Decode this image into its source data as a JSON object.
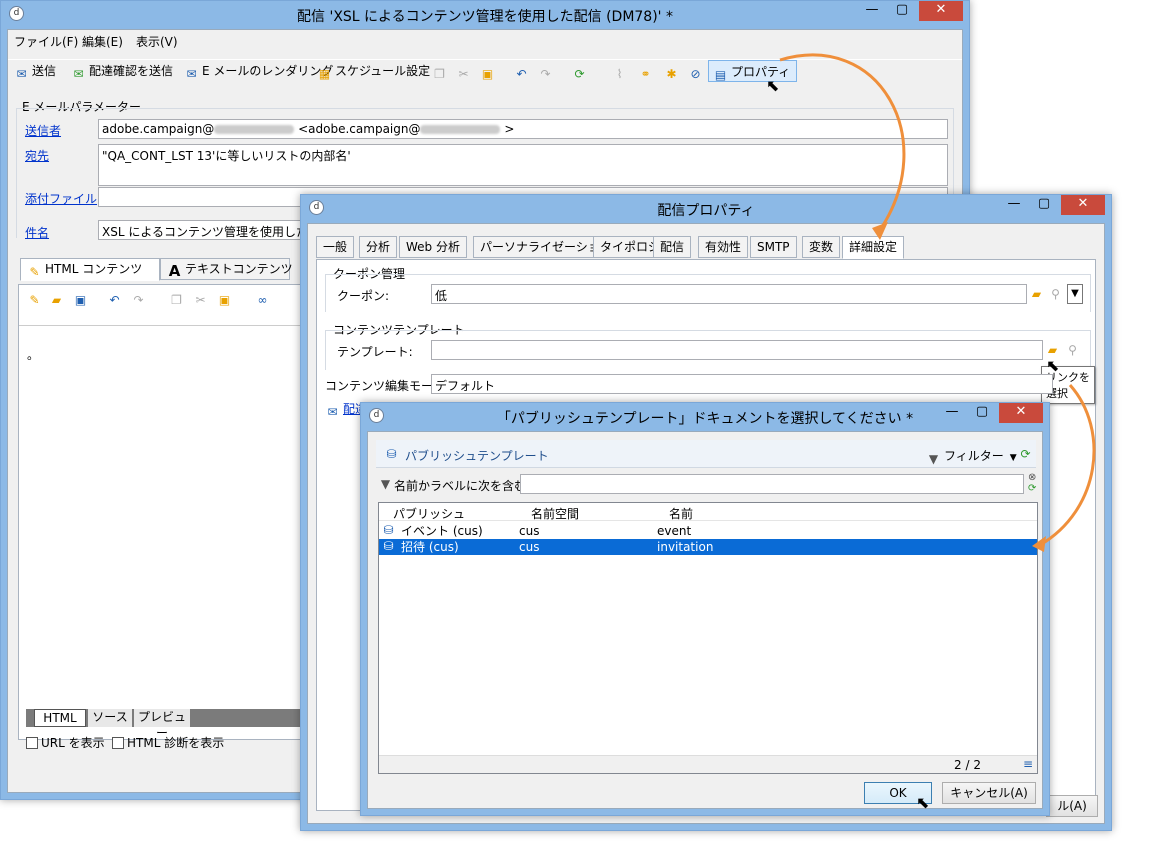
{
  "main_window": {
    "title": "配信 'XSL によるコンテンツ管理を使用した配信 (DM78)' *",
    "menu": [
      "ファイル(F)",
      "編集(E)",
      "表示(V)"
    ],
    "toolbar": {
      "send": "送信",
      "send_proof": "配達確認を送信",
      "render": "E メールのレンダリング",
      "schedule": "スケジュール設定",
      "properties": "プロパティ"
    },
    "email_params": {
      "legend": "E メールパラメーター",
      "sender_label": "送信者",
      "sender_value_prefix": "adobe.campaign@",
      "sender_value_mid": "<adobe.campaign@",
      "sender_value_end": ">",
      "to_label": "宛先",
      "to_value": "\"QA_CONT_LST 13'に等しいリストの内部名'",
      "attach_label": "添付ファイル",
      "subject_label": "件名",
      "subject_value": "XSL によるコンテンツ管理を使用した配信"
    },
    "content_tabs": [
      "HTML コンテンツ",
      "テキストコンテンツ"
    ],
    "editor_text": "。",
    "bottom_tabs": [
      "HTML",
      "ソース",
      "プレビュー"
    ],
    "show_url": "URL を表示",
    "show_html_diag": "HTML 診断を表示"
  },
  "props_dialog": {
    "title": "配信プロパティ",
    "tabs": [
      "一般",
      "分析",
      "Web 分析",
      "パーソナライゼーション",
      "タイポロジ",
      "配信",
      "有効性",
      "SMTP",
      "変数",
      "詳細設定"
    ],
    "active_tab": "詳細設定",
    "coupon_group": "クーポン管理",
    "coupon_label": "クーポン:",
    "coupon_value": "低",
    "template_group": "コンテンツテンプレート",
    "template_label": "テンプレート:",
    "template_value": "",
    "tooltip": "リンクを選択",
    "edit_mode_label": "コンテンツ編集モード:",
    "edit_mode_value": "デフォルト",
    "hidden_link": "配達確認プロ",
    "close_btn_fragment": "ル(A)"
  },
  "select_dialog": {
    "title": "「パブリッシュテンプレート」ドキュメントを選択してください *",
    "header": "パブリッシュテンプレート",
    "filter": "フィルター",
    "search_label": "名前かラベルに次を含む:",
    "search_value": "",
    "columns": [
      "パブリッシュ",
      "名前空間",
      "名前"
    ],
    "rows": [
      {
        "label": "イベント (cus)",
        "namespace": "cus",
        "name": "event"
      },
      {
        "label": "招待 (cus)",
        "namespace": "cus",
        "name": "invitation"
      }
    ],
    "count": "2 / 2",
    "ok": "OK",
    "cancel": "キャンセル(A)"
  },
  "colors": {
    "title_bg": "#8cb9e6",
    "accent_orange": "#ef8f3b",
    "selection": "#0a6bd6",
    "link": "#0033cc"
  }
}
